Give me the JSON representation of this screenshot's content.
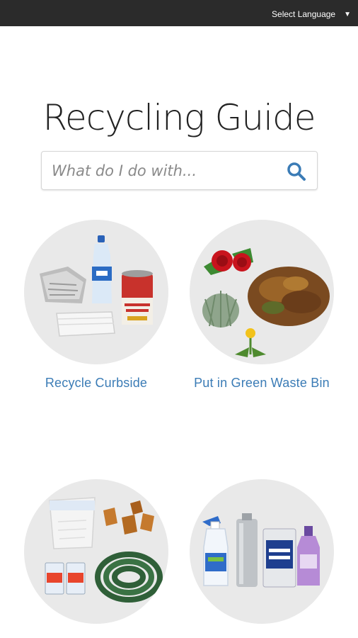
{
  "header": {
    "language_label": "Select Language",
    "language_caret": "▼"
  },
  "page": {
    "title": "Recycling Guide"
  },
  "search": {
    "placeholder": "What do I do with..."
  },
  "categories": [
    {
      "label": "Recycle Curbside",
      "icon": "recyclables-icon"
    },
    {
      "label": "Put in Green Waste Bin",
      "icon": "green-waste-icon"
    },
    {
      "label": "",
      "icon": "trash-items-icon"
    },
    {
      "label": "",
      "icon": "hazardous-waste-icon"
    }
  ],
  "colors": {
    "topbar": "#2b2b2b",
    "link": "#3b7cb6",
    "search_icon": "#3b7cb6",
    "circle": "#e9e9e9"
  }
}
